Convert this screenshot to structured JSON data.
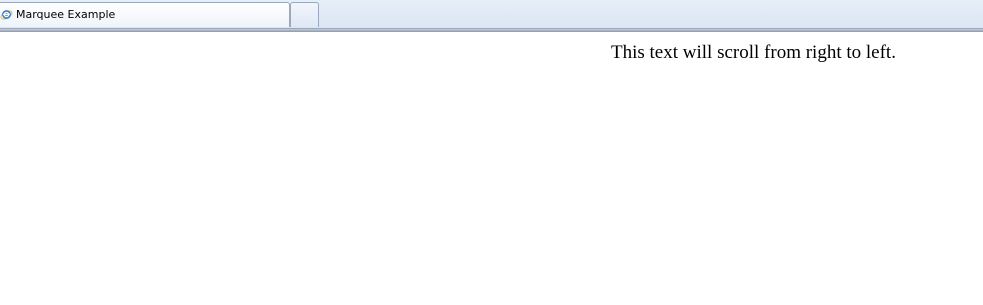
{
  "tabs": [
    {
      "title": "Marquee Example",
      "icon": "ie-icon",
      "active": true
    },
    {
      "title": "",
      "icon": "",
      "active": false
    }
  ],
  "page": {
    "marquee_text": "This text will scroll from right to left."
  },
  "colors": {
    "tab_strip": "#dbe6f4",
    "tab_border": "#9aa9bd",
    "ie_blue": "#2f7fd3",
    "ie_ring": "#f2c14e"
  }
}
